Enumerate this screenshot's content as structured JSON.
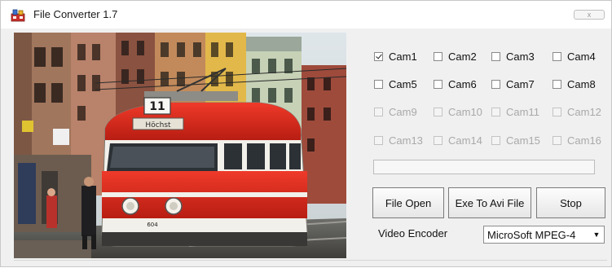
{
  "window": {
    "title": "File Converter 1.7",
    "close_glyph": "x"
  },
  "cameras": [
    {
      "label": "Cam1",
      "checked": true,
      "enabled": true
    },
    {
      "label": "Cam2",
      "checked": false,
      "enabled": true
    },
    {
      "label": "Cam3",
      "checked": false,
      "enabled": true
    },
    {
      "label": "Cam4",
      "checked": false,
      "enabled": true
    },
    {
      "label": "Cam5",
      "checked": false,
      "enabled": true
    },
    {
      "label": "Cam6",
      "checked": false,
      "enabled": true
    },
    {
      "label": "Cam7",
      "checked": false,
      "enabled": true
    },
    {
      "label": "Cam8",
      "checked": false,
      "enabled": true
    },
    {
      "label": "Cam9",
      "checked": false,
      "enabled": false
    },
    {
      "label": "Cam10",
      "checked": false,
      "enabled": false
    },
    {
      "label": "Cam11",
      "checked": false,
      "enabled": false
    },
    {
      "label": "Cam12",
      "checked": false,
      "enabled": false
    },
    {
      "label": "Cam13",
      "checked": false,
      "enabled": false
    },
    {
      "label": "Cam14",
      "checked": false,
      "enabled": false
    },
    {
      "label": "Cam15",
      "checked": false,
      "enabled": false
    },
    {
      "label": "Cam16",
      "checked": false,
      "enabled": false
    }
  ],
  "video": {
    "tram_number": "11",
    "tram_destination": "Höchst",
    "tram_fleet_number": "604"
  },
  "progress": {
    "value": 0
  },
  "buttons": {
    "file_open": "File Open",
    "exe_to_avi": "Exe To Avi File",
    "stop": "Stop"
  },
  "encoder": {
    "label": "Video Encoder",
    "selected": "MicroSoft MPEG-4"
  },
  "icons": {
    "app": "app-icon",
    "close": "close-icon",
    "dropdown": "chevron-down-icon",
    "checkmark": "checkmark-icon"
  }
}
